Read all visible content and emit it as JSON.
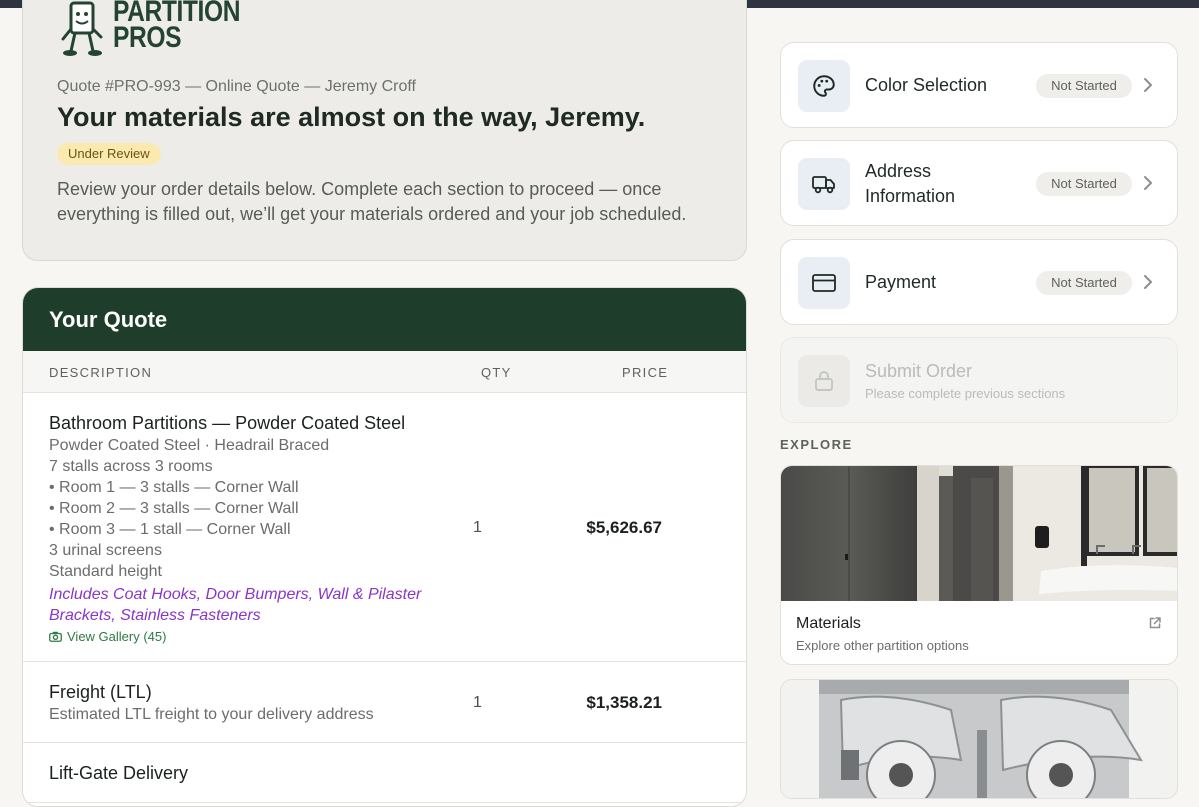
{
  "brand": {
    "line1": "PARTITION",
    "line2": "PROS"
  },
  "hero": {
    "meta": "Quote #PRO-993 — Online Quote — Jeremy Croff",
    "title": "Your materials are almost on the way, Jeremy.",
    "status": "Under Review",
    "description": "Review your order details below. Complete each section to proceed — once everything is filled out, we’ll get your materials ordered and your job scheduled."
  },
  "quote": {
    "title": "Your Quote",
    "columns": {
      "description": "DESCRIPTION",
      "qty": "QTY",
      "price": "PRICE"
    },
    "items": [
      {
        "title": "Bathroom Partitions — Powder Coated Steel",
        "lines": [
          "Powder Coated Steel · Headrail Braced",
          "7 stalls across 3 rooms",
          "• Room 1 — 3 stalls — Corner Wall",
          "• Room 2 — 3 stalls — Corner Wall",
          "• Room 3 — 1 stall — Corner Wall",
          "3 urinal screens",
          "Standard height"
        ],
        "includes": "Includes Coat Hooks, Door Bumpers, Wall & Pilaster Brackets, Stainless Fasteners",
        "gallery": "View Gallery (45)",
        "qty": "1",
        "price": "$5,626.67"
      },
      {
        "title": "Freight (LTL)",
        "lines": [
          "Estimated LTL freight to your delivery address"
        ],
        "qty": "1",
        "price": "$1,358.21"
      },
      {
        "title": "Lift-Gate Delivery"
      }
    ]
  },
  "steps": [
    {
      "label": "Color Selection",
      "status": "Not Started",
      "icon": "palette-icon"
    },
    {
      "label": "Address Information",
      "status": "Not Started",
      "icon": "truck-icon"
    },
    {
      "label": "Payment",
      "status": "Not Started",
      "icon": "credit-card-icon"
    },
    {
      "label": "Submit Order",
      "sub": "Please complete previous sections",
      "icon": "lock-icon"
    }
  ],
  "explore": {
    "heading": "EXPLORE",
    "tiles": [
      {
        "name": "Materials",
        "sub": "Explore other partition options"
      }
    ]
  },
  "colors": {
    "brand_green": "#1f3d2b",
    "accent_purple": "#8a35c9",
    "pill_yellow": "#fbeab0",
    "link_green": "#2f7a44"
  }
}
